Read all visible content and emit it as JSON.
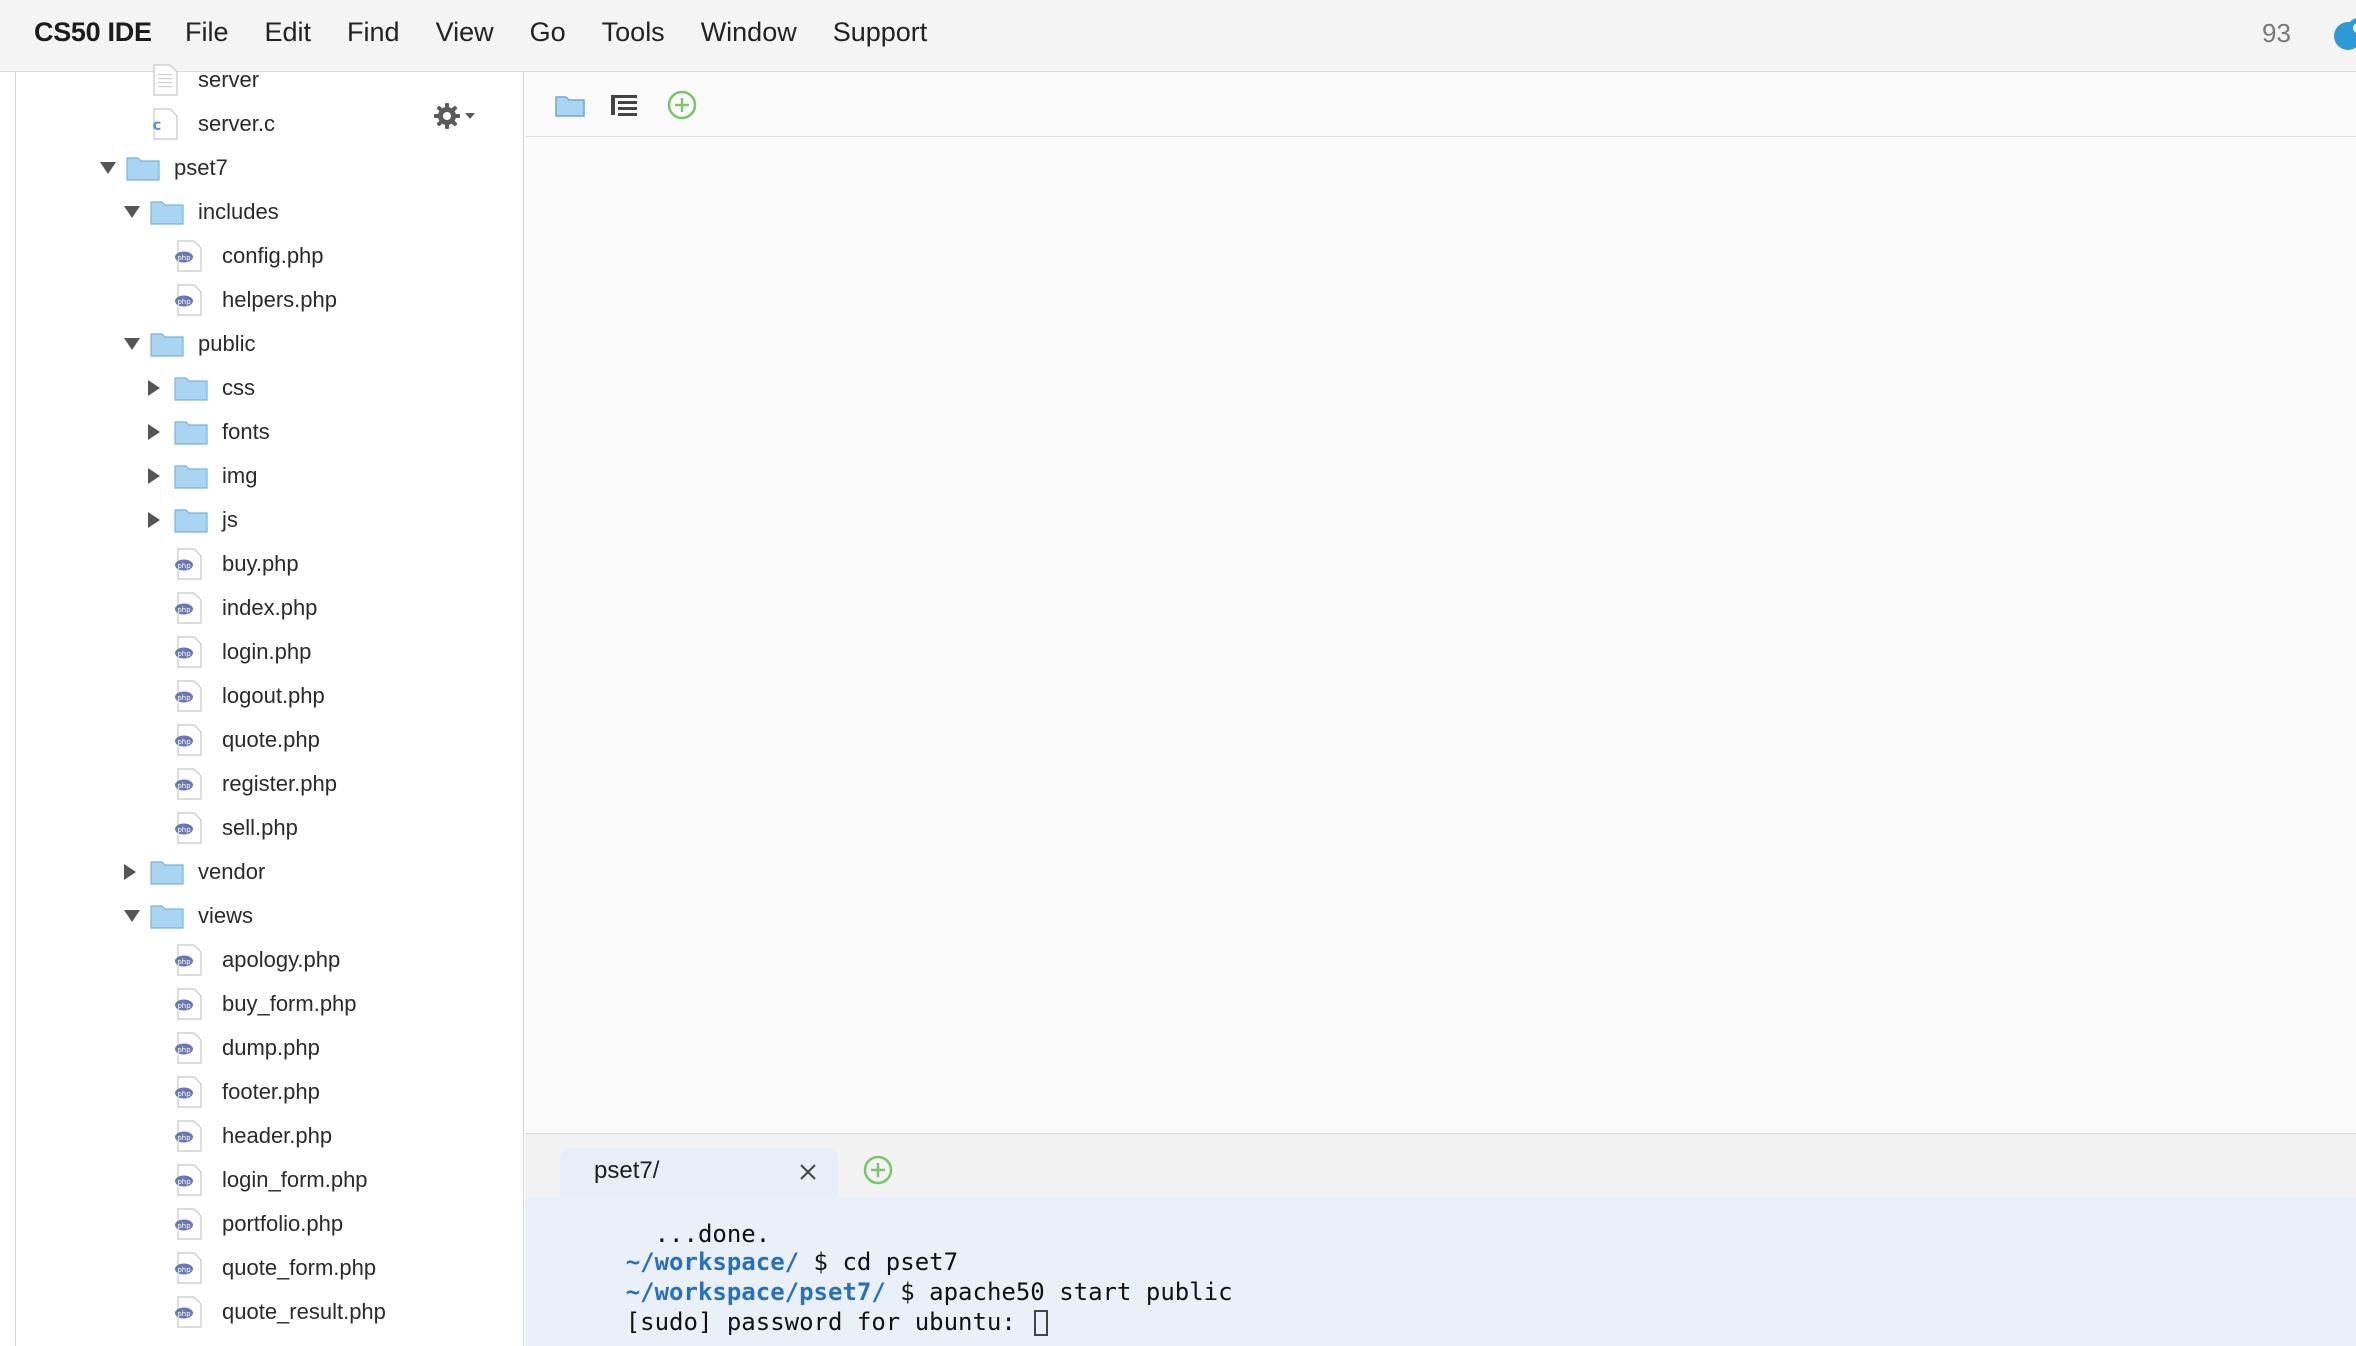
{
  "menubar": {
    "brand": "CS50 IDE",
    "items": [
      "File",
      "Edit",
      "Find",
      "View",
      "Go",
      "Tools",
      "Window",
      "Support"
    ],
    "counter": "93"
  },
  "tree": [
    {
      "label": "server",
      "kind": "file-plain",
      "depth": 2
    },
    {
      "label": "server.c",
      "kind": "file-c",
      "depth": 2
    },
    {
      "label": "pset7",
      "kind": "folder",
      "depth": 1,
      "expanded": true
    },
    {
      "label": "includes",
      "kind": "folder",
      "depth": 2,
      "expanded": true
    },
    {
      "label": "config.php",
      "kind": "file-php",
      "depth": 3
    },
    {
      "label": "helpers.php",
      "kind": "file-php",
      "depth": 3
    },
    {
      "label": "public",
      "kind": "folder",
      "depth": 2,
      "expanded": true
    },
    {
      "label": "css",
      "kind": "folder",
      "depth": 3,
      "expanded": false
    },
    {
      "label": "fonts",
      "kind": "folder",
      "depth": 3,
      "expanded": false
    },
    {
      "label": "img",
      "kind": "folder",
      "depth": 3,
      "expanded": false
    },
    {
      "label": "js",
      "kind": "folder",
      "depth": 3,
      "expanded": false
    },
    {
      "label": "buy.php",
      "kind": "file-php",
      "depth": 3
    },
    {
      "label": "index.php",
      "kind": "file-php",
      "depth": 3
    },
    {
      "label": "login.php",
      "kind": "file-php",
      "depth": 3
    },
    {
      "label": "logout.php",
      "kind": "file-php",
      "depth": 3
    },
    {
      "label": "quote.php",
      "kind": "file-php",
      "depth": 3
    },
    {
      "label": "register.php",
      "kind": "file-php",
      "depth": 3
    },
    {
      "label": "sell.php",
      "kind": "file-php",
      "depth": 3
    },
    {
      "label": "vendor",
      "kind": "folder",
      "depth": 2,
      "expanded": false
    },
    {
      "label": "views",
      "kind": "folder",
      "depth": 2,
      "expanded": true
    },
    {
      "label": "apology.php",
      "kind": "file-php",
      "depth": 3
    },
    {
      "label": "buy_form.php",
      "kind": "file-php",
      "depth": 3
    },
    {
      "label": "dump.php",
      "kind": "file-php",
      "depth": 3
    },
    {
      "label": "footer.php",
      "kind": "file-php",
      "depth": 3
    },
    {
      "label": "header.php",
      "kind": "file-php",
      "depth": 3
    },
    {
      "label": "login_form.php",
      "kind": "file-php",
      "depth": 3
    },
    {
      "label": "portfolio.php",
      "kind": "file-php",
      "depth": 3
    },
    {
      "label": "quote_form.php",
      "kind": "file-php",
      "depth": 3
    },
    {
      "label": "quote_result.php",
      "kind": "file-php",
      "depth": 3
    }
  ],
  "icons": {
    "gear": "gear-icon",
    "toolbar": [
      "folder-icon",
      "outline-icon",
      "add-tab-icon"
    ]
  },
  "terminal": {
    "tab_label": "pset7/",
    "lines": [
      {
        "path": "",
        "text": "  ...done."
      },
      {
        "path": "~/workspace/",
        "text": " $ cd pset7"
      },
      {
        "path": "~/workspace/pset7/",
        "text": " $ apache50 start public"
      },
      {
        "path": "",
        "text": "[sudo] password for ubuntu: "
      }
    ]
  },
  "colors": {
    "folder": "#a9d4f2",
    "php_icon": "#6a78b3",
    "accent_green": "#7cc46c",
    "terminal_bg": "#e9f0f8",
    "terminal_path": "#2a70b8",
    "cloud": "#2a9bd8"
  }
}
